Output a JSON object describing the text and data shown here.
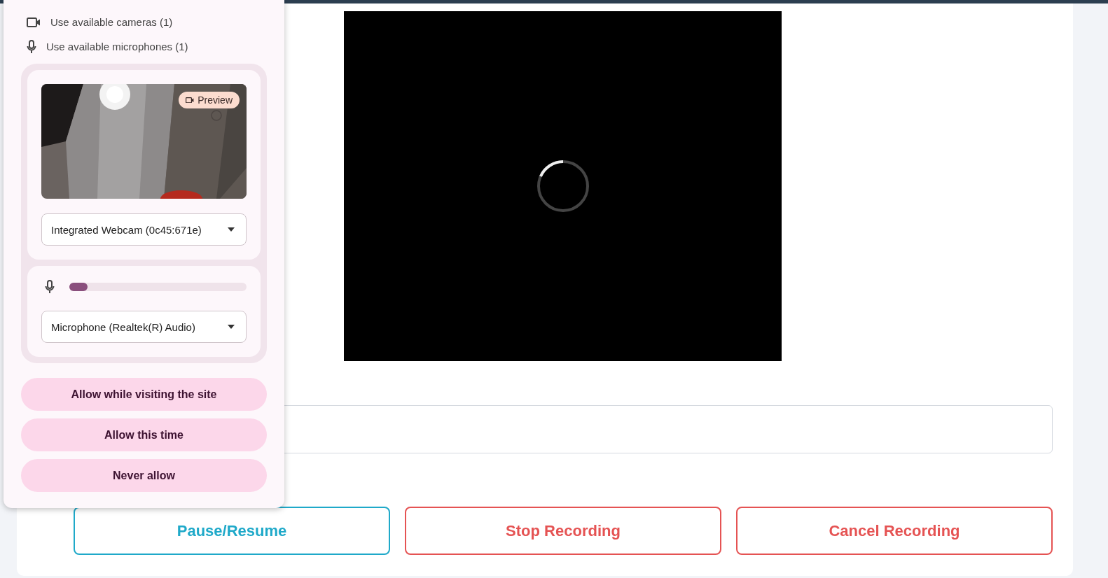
{
  "permission_popup": {
    "permissions": [
      {
        "kind": "camera",
        "label": "Use available cameras (1)"
      },
      {
        "kind": "microphone",
        "label": "Use available microphones (1)"
      }
    ],
    "camera": {
      "badge": "Preview",
      "device": "Integrated Webcam (0c45:671e)"
    },
    "microphone": {
      "level": 0.1,
      "device": "Microphone (Realtek(R) Audio)"
    },
    "buttons": [
      "Allow while visiting the site",
      "Allow this time",
      "Never allow"
    ]
  },
  "recorder": {
    "video": {
      "loading": true
    },
    "buttons": [
      {
        "label": "Pause/Resume",
        "kind": "primary"
      },
      {
        "label": "Stop Recording",
        "kind": "danger"
      },
      {
        "label": "Cancel Recording",
        "kind": "danger"
      }
    ]
  }
}
